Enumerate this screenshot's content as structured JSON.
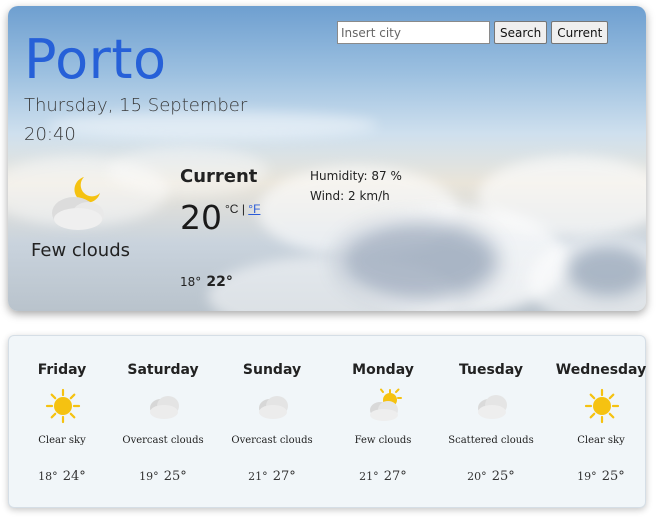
{
  "current": {
    "city": "Porto",
    "date": "Thursday, 15 September",
    "time": "20:40",
    "icon": "night-few-clouds-icon",
    "description": "Few clouds",
    "label": "Current",
    "temp": "20",
    "unit_c": "°C",
    "unit_sep": "|",
    "unit_f": "°F",
    "min": "18°",
    "max": "22°",
    "humidity": "Humidity: 87 %",
    "wind": "Wind: 2 km/h"
  },
  "search": {
    "placeholder": "Insert city",
    "search_label": "Search",
    "current_label": "Current"
  },
  "forecast": [
    {
      "day": "Friday",
      "icon": "sun-icon",
      "desc": "Clear sky",
      "min": "18°",
      "max": "24°"
    },
    {
      "day": "Saturday",
      "icon": "overcast-clouds-icon",
      "desc": "Overcast clouds",
      "min": "19°",
      "max": "25°"
    },
    {
      "day": "Sunday",
      "icon": "overcast-clouds-icon",
      "desc": "Overcast clouds",
      "min": "21°",
      "max": "27°"
    },
    {
      "day": "Monday",
      "icon": "few-clouds-icon",
      "desc": "Few clouds",
      "min": "21°",
      "max": "27°"
    },
    {
      "day": "Tuesday",
      "icon": "scattered-clouds-icon",
      "desc": "Scattered clouds",
      "min": "20°",
      "max": "25°"
    },
    {
      "day": "Wednesday",
      "icon": "sun-icon",
      "desc": "Clear sky",
      "min": "19°",
      "max": "25°"
    }
  ],
  "colors": {
    "city": "#2660d8",
    "link": "#2a5bd7",
    "sun": "#f5c211",
    "forecast_bg": "#f1f6f9"
  }
}
